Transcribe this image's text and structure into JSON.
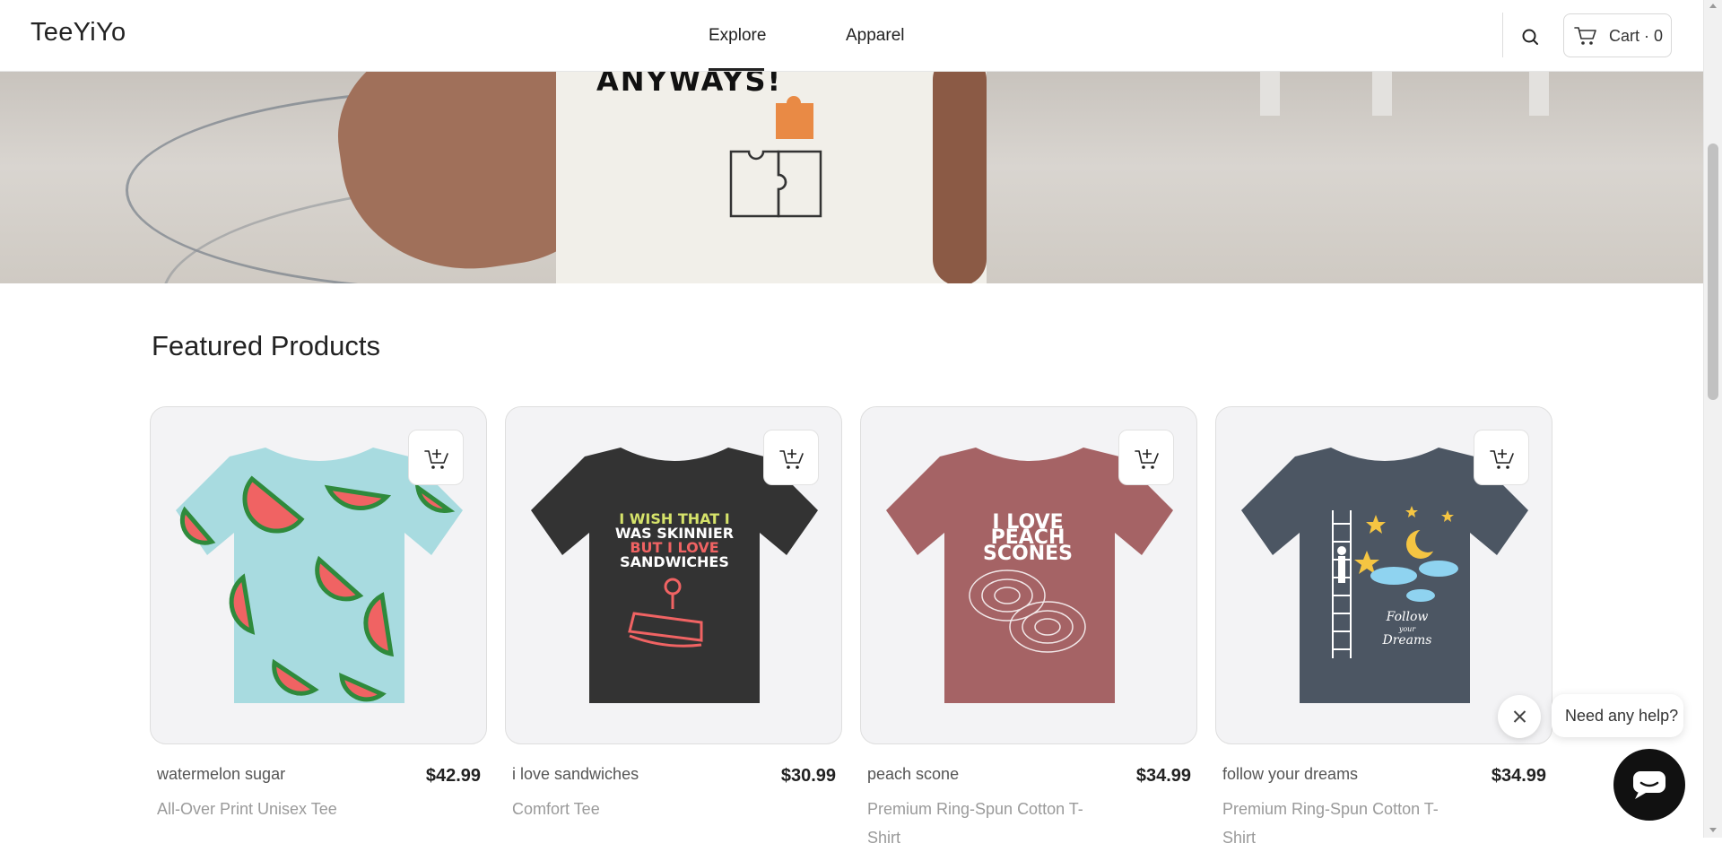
{
  "header": {
    "logo": "TeeYiYo",
    "nav": [
      {
        "label": "Explore",
        "active": true
      },
      {
        "label": "Apparel",
        "active": false
      }
    ],
    "cart_label": "Cart · 0",
    "search_icon": "search-icon",
    "cart_icon": "cart-icon"
  },
  "hero": {
    "shirt_text": "ANYWAYS!"
  },
  "featured": {
    "title": "Featured Products",
    "add_to_cart_icon": "add-to-cart-icon",
    "products": [
      {
        "name": "watermelon sugar",
        "price": "$42.99",
        "category": "All-Over Print Unisex Tee",
        "shirt_color": "#a8dbe0"
      },
      {
        "name": "i love sandwiches",
        "price": "$30.99",
        "category": "Comfort Tee",
        "shirt_color": "#333333",
        "design_text": [
          "I WISH THAT I",
          "WAS SKINNIER",
          "BUT I LOVE",
          "SANDWICHES"
        ]
      },
      {
        "name": "peach scone",
        "price": "$34.99",
        "category": "Premium Ring-Spun Cotton T-Shirt",
        "shirt_color": "#a56365",
        "design_text": [
          "I LOVE",
          "PEACH",
          "SCONES"
        ]
      },
      {
        "name": "follow your dreams",
        "price": "$34.99",
        "category": "Premium Ring-Spun Cotton T-Shirt",
        "shirt_color": "#4c5663",
        "design_text": [
          "Follow",
          "your",
          "Dreams"
        ]
      }
    ]
  },
  "chat": {
    "prompt": "Need any help?",
    "close_icon": "close-icon",
    "chat_icon": "chat-icon"
  },
  "colors": {
    "card_bg": "#f3f3f5",
    "chat_button": "#111111"
  }
}
